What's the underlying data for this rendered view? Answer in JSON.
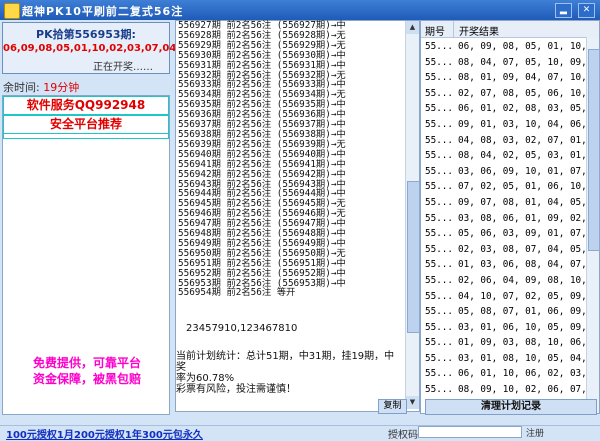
{
  "window": {
    "title": "超神PK10平刷前二复式56注"
  },
  "left_panel": {
    "issue_label": "PK拾第556953期:",
    "issue_numbers": "06,09,08,05,01,10,02,03,07,04",
    "issue_status": "正在开奖……",
    "timer_label": "余时间:",
    "timer_value": "19分钟",
    "ad_service": "软件服务QQ992948",
    "ad_platform": "安全平台推荐",
    "promo_line1": "免费提供，可靠平台",
    "promo_line2": "资金保障，被黑包赔"
  },
  "log": {
    "lines": [
      "556927期 前2名56注 (556927期)→中",
      "556928期 前2名56注 (556928期)→无",
      "556929期 前2名56注 (556929期)→无",
      "556930期 前2名56注 (556930期)→中",
      "556931期 前2名56注 (556931期)→中",
      "556932期 前2名56注 (556932期)→无",
      "556933期 前2名56注 (556933期)→中",
      "556934期 前2名56注 (556934期)→无",
      "556935期 前2名56注 (556935期)→中",
      "556936期 前2名56注 (556936期)→中",
      "556937期 前2名56注 (556937期)→中",
      "556938期 前2名56注 (556938期)→中",
      "556939期 前2名56注 (556939期)→无",
      "556940期 前2名56注 (556940期)→中",
      "556941期 前2名56注 (556941期)→中",
      "556942期 前2名56注 (556942期)→中",
      "556943期 前2名56注 (556943期)→中",
      "556944期 前2名56注 (556944期)→中",
      "556945期 前2名56注 (556945期)→无",
      "556946期 前2名56注 (556946期)→无",
      "556947期 前2名56注 (556947期)→中",
      "556948期 前2名56注 (556948期)→中",
      "556949期 前2名56注 (556949期)→中",
      "556950期 前2名56注 (556950期)→无",
      "556951期 前2名56注 (556951期)→中",
      "556952期 前2名56注 (556952期)→中",
      "556953期 前2名56注 (556953期)→中",
      "556954期 前2名56注 等开"
    ],
    "plan_numbers": "23457910,123467810",
    "stats_line1": "当前计划统计：总计51期，中31期，挂19期，中奖",
    "stats_line2": "率为60.78%",
    "stats_line3": "彩票有风险，投注需谨慎！",
    "copy_label": "复制"
  },
  "results": {
    "col_issue": "期号",
    "col_result": "开奖结果",
    "rows": [
      [
        "55...",
        "06, 09, 08, 05, 01, 10,0..."
      ],
      [
        "55...",
        "08, 04, 07, 05, 10, 09,0..."
      ],
      [
        "55...",
        "08, 01, 09, 04, 07, 10,0..."
      ],
      [
        "55...",
        "02, 07, 08, 05, 06, 10,0..."
      ],
      [
        "55...",
        "06, 01, 02, 08, 03, 05,0..."
      ],
      [
        "55...",
        "09, 01, 03, 10, 04, 06,0..."
      ],
      [
        "55...",
        "04, 08, 03, 02, 07, 01,0..."
      ],
      [
        "55...",
        "08, 04, 02, 05, 03, 01,0..."
      ],
      [
        "55...",
        "03, 06, 09, 10, 01, 07,0..."
      ],
      [
        "55...",
        "07, 02, 05, 01, 06, 10,0..."
      ],
      [
        "55...",
        "09, 07, 08, 01, 04, 05,0..."
      ],
      [
        "55...",
        "03, 08, 06, 01, 09, 02,1..."
      ],
      [
        "55...",
        "05, 06, 03, 09, 01, 07,0..."
      ],
      [
        "55...",
        "02, 03, 08, 07, 04, 05,0..."
      ],
      [
        "55...",
        "01, 03, 06, 08, 04, 07,0..."
      ],
      [
        "55...",
        "02, 06, 04, 09, 08, 10,0..."
      ],
      [
        "55...",
        "04, 10, 07, 02, 05, 09,0..."
      ],
      [
        "55...",
        "05, 08, 07, 01, 06, 09,0..."
      ],
      [
        "55...",
        "03, 01, 06, 10, 05, 09,0..."
      ],
      [
        "55...",
        "01, 09, 03, 08, 10, 06,0..."
      ],
      [
        "55...",
        "03, 01, 08, 10, 05, 04,0..."
      ],
      [
        "55...",
        "06, 01, 10, 06, 02, 03,0..."
      ],
      [
        "55...",
        "08, 09, 10, 02, 06, 07,0..."
      ],
      [
        "55...",
        "08, 03, 09, 05, 10, 04,0..."
      ]
    ],
    "clear_label": "清理计划记录"
  },
  "bottom": {
    "license_1": "100元授权1月",
    "license_2": "200元授权1年",
    "license_3": "300元包永久",
    "auth_label": "授权码:",
    "auth_value": "",
    "register_label": "注册"
  }
}
